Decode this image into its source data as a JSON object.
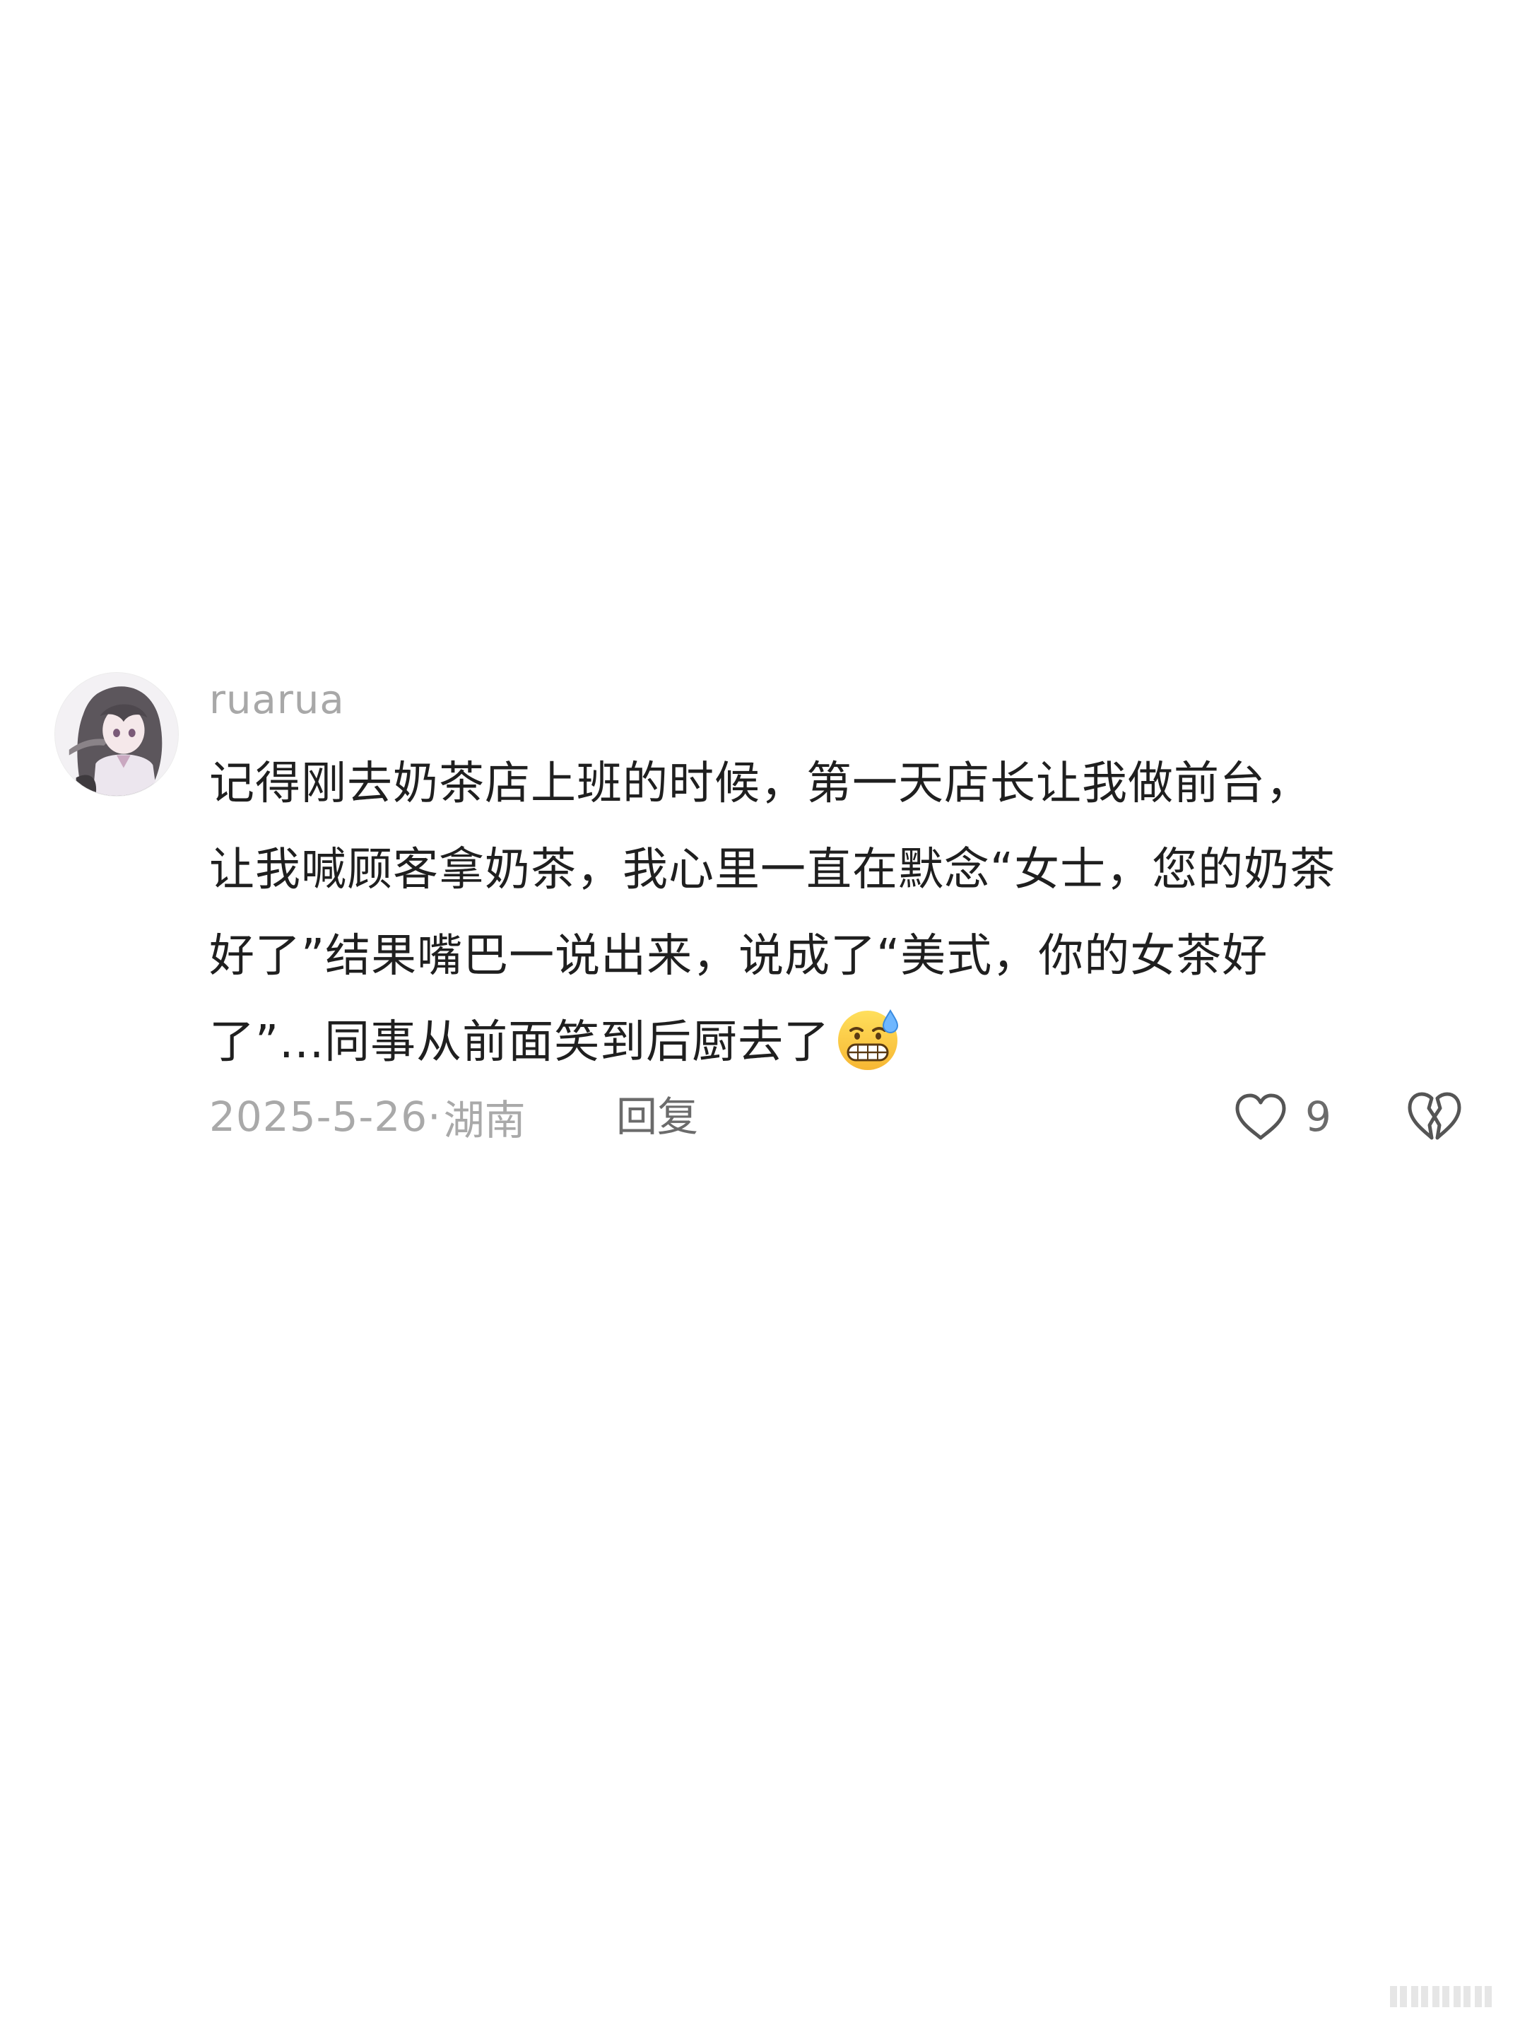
{
  "comment": {
    "username": "ruarua",
    "content_lines": [
      "记得刚去奶茶店上班的时候，第一天店长让我做前台，",
      "让我喊顾客拿奶茶，我心里一直在默念“女士，您的奶茶",
      "好了”结果嘴巴一说出来，说成了“美式，你的女茶好",
      "了”...同事从前面笑到后厨去了"
    ],
    "emoji": "grinning-sweat-emoji",
    "date": "2025-5-26",
    "separator": "·",
    "location": "湖南",
    "reply_label": "回复",
    "like_count": "9",
    "icons": {
      "like": "heart-outline-icon",
      "dislike": "broken-heart-icon"
    }
  }
}
